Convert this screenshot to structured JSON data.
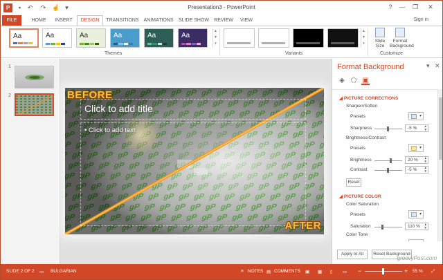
{
  "window": {
    "title": "Presentation3 - PowerPoint",
    "app_icon": "P",
    "controls": [
      "?",
      "—",
      "❐",
      "✕"
    ]
  },
  "qat": [
    "save-icon",
    "undo-icon",
    "redo-icon",
    "touch-mode-icon",
    "customize-qat-icon"
  ],
  "tabs": {
    "file": "FILE",
    "home": "HOME",
    "insert": "INSERT",
    "design": "DESIGN",
    "transitions": "TRANSITIONS",
    "animations": "ANIMATIONS",
    "slideshow": "SLIDE SHOW",
    "review": "REVIEW",
    "view": "VIEW",
    "sign_in": "Sign in"
  },
  "ribbon": {
    "themes_label": "Themes",
    "variants_label": "Variants",
    "customize_label": "Customize",
    "slide_size": "Slide Size",
    "format_background": "Format Background",
    "theme_aa": "Aa",
    "themes": [
      {
        "bg": "#ffffff",
        "bars": [
          "#4472c4",
          "#ed7d31",
          "#a5a5a5",
          "#ffc000"
        ],
        "selected": true
      },
      {
        "bg": "#ffffff",
        "bars": [
          "#5b9bd5",
          "#70ad47",
          "#ffc000",
          "#264478"
        ],
        "selected": false
      },
      {
        "bg": "#e9f1dc",
        "bars": [
          "#7bad2e",
          "#4b8a1e",
          "#a4c25b",
          "#2f5d0f"
        ],
        "selected": false
      },
      {
        "bg": "#4b9ccb",
        "bars": [
          "#1f5d8c",
          "#8fc2e3",
          "#ffffff",
          "#2f7fb5"
        ],
        "selected": false
      },
      {
        "bg": "#2c5e55",
        "bars": [
          "#6cc0a8",
          "#3c8b75",
          "#c7e6dc",
          "#1a3f37"
        ],
        "selected": false
      },
      {
        "bg": "#3a2d63",
        "bars": [
          "#b04fa6",
          "#e27bd0",
          "#7a5fc5",
          "#f0a7e3"
        ],
        "selected": false
      }
    ],
    "variants": [
      "#ffffff",
      "#ffffff",
      "#000000",
      "#111111"
    ]
  },
  "slides": {
    "numbers": [
      "1",
      "2"
    ]
  },
  "slide": {
    "title_placeholder": "Click to add title",
    "body_placeholder": "• Click to add text",
    "before_label": "BEFORE",
    "after_label": "AFTER"
  },
  "pane": {
    "title": "Format Background",
    "close": "✕",
    "options": "▾",
    "picture_corrections": "PICTURE CORRECTIONS",
    "sharpen_soften": "Sharpen/Soften",
    "presets": "Presets",
    "sharpness": "Sharpness",
    "sharpness_value": "-5 %",
    "brightness_contrast": "Brightness/Contrast",
    "brightness": "Brightness",
    "brightness_value": "20 %",
    "contrast": "Contrast",
    "contrast_value": "-5 %",
    "reset": "Reset",
    "picture_color": "PICTURE COLOR",
    "color_saturation": "Color Saturation",
    "saturation": "Saturation",
    "saturation_value": "110 %",
    "color_tone": "Color Tone",
    "apply_to_all": "Apply to All",
    "reset_background": "Reset Background",
    "sharpness_level": 0.48,
    "brightness_level": 0.6,
    "contrast_level": 0.48,
    "saturation_level": 0.27
  },
  "status": {
    "slide_of": "SLIDE 2 OF 2",
    "language": "BULGARIAN",
    "notes": "NOTES",
    "comments": "COMMENTS",
    "zoom": "55 %",
    "zoom_minus": "−",
    "zoom_plus": "+"
  },
  "watermark": "groovyPost.com",
  "colors": {
    "accent": "#d24726",
    "diagonal": "#f39a1e",
    "label": "#f7c04a"
  }
}
